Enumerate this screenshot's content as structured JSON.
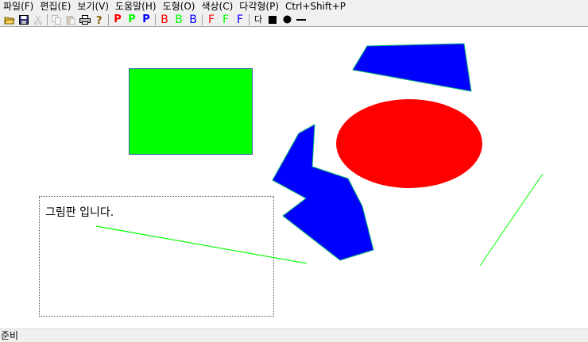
{
  "menu": [
    "파일(F)",
    "편집(E)",
    "보기(V)",
    "도움말(H)",
    "도형(O)",
    "색상(C)",
    "다각형(P)"
  ],
  "menu_extra": "Ctrl+Shift+P",
  "toolbar": {
    "pen_letter": "P",
    "brush_letter": "B",
    "fill_letter": "F",
    "polygon_label": "다",
    "icons": [
      "open-icon",
      "save-icon",
      "cut-icon",
      "copy-icon",
      "paste-icon",
      "print-icon",
      "help-icon",
      "pen-red",
      "pen-green",
      "pen-blue",
      "brush-red",
      "brush-green",
      "brush-blue",
      "fill-red",
      "fill-green",
      "fill-blue",
      "polygon",
      "rectangle",
      "ellipse",
      "line"
    ]
  },
  "colors": {
    "red": "#ff0000",
    "green": "#00ff00",
    "blue": "#0000ff",
    "border_green": "#00cc66"
  },
  "canvas_text": "그림판 입니다.",
  "status": "준비"
}
